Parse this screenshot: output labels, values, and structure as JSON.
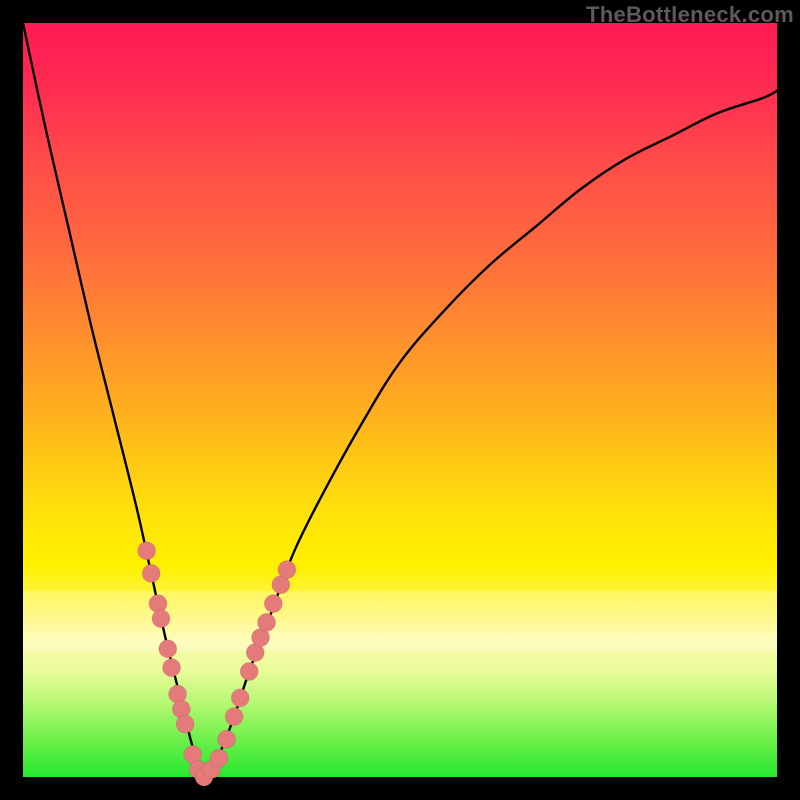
{
  "watermark": "TheBottleneck.com",
  "colors": {
    "curve": "#000000",
    "marker": "#e47a7a",
    "frame_bg": "#000000",
    "gradient_top": "#ff1a54",
    "gradient_bottom": "#25e82e"
  },
  "chart_data": {
    "type": "line",
    "title": "",
    "xlabel": "",
    "ylabel": "",
    "xlim": [
      0,
      100
    ],
    "ylim": [
      0,
      100
    ],
    "grid": false,
    "legend": false,
    "series": [
      {
        "name": "bottleneck-curve",
        "x": [
          0,
          3,
          6,
          9,
          12,
          15,
          17,
          19,
          21,
          22.5,
          24,
          26,
          28,
          30,
          33,
          36,
          40,
          45,
          50,
          56,
          62,
          68,
          74,
          80,
          86,
          92,
          98,
          100
        ],
        "y": [
          100,
          86,
          73,
          60,
          48,
          36,
          27,
          18,
          10,
          4,
          0,
          3,
          8,
          14,
          22,
          30,
          38,
          47,
          55,
          62,
          68,
          73,
          78,
          82,
          85,
          88,
          90,
          91
        ]
      }
    ],
    "markers": {
      "name": "highlighted-points",
      "color": "#e47a7a",
      "points": [
        {
          "x": 16.4,
          "y": 30
        },
        {
          "x": 17.0,
          "y": 27
        },
        {
          "x": 17.9,
          "y": 23
        },
        {
          "x": 18.3,
          "y": 21
        },
        {
          "x": 19.2,
          "y": 17
        },
        {
          "x": 19.7,
          "y": 14.5
        },
        {
          "x": 20.5,
          "y": 11
        },
        {
          "x": 21.0,
          "y": 9
        },
        {
          "x": 21.5,
          "y": 7
        },
        {
          "x": 22.5,
          "y": 3
        },
        {
          "x": 23.2,
          "y": 1
        },
        {
          "x": 24.0,
          "y": 0
        },
        {
          "x": 25.0,
          "y": 1
        },
        {
          "x": 26.0,
          "y": 2.5
        },
        {
          "x": 27.0,
          "y": 5
        },
        {
          "x": 28.0,
          "y": 8
        },
        {
          "x": 28.8,
          "y": 10.5
        },
        {
          "x": 30.0,
          "y": 14
        },
        {
          "x": 30.8,
          "y": 16.5
        },
        {
          "x": 31.5,
          "y": 18.5
        },
        {
          "x": 32.3,
          "y": 20.5
        },
        {
          "x": 33.2,
          "y": 23
        },
        {
          "x": 34.2,
          "y": 25.5
        },
        {
          "x": 35.0,
          "y": 27.5
        }
      ]
    }
  }
}
